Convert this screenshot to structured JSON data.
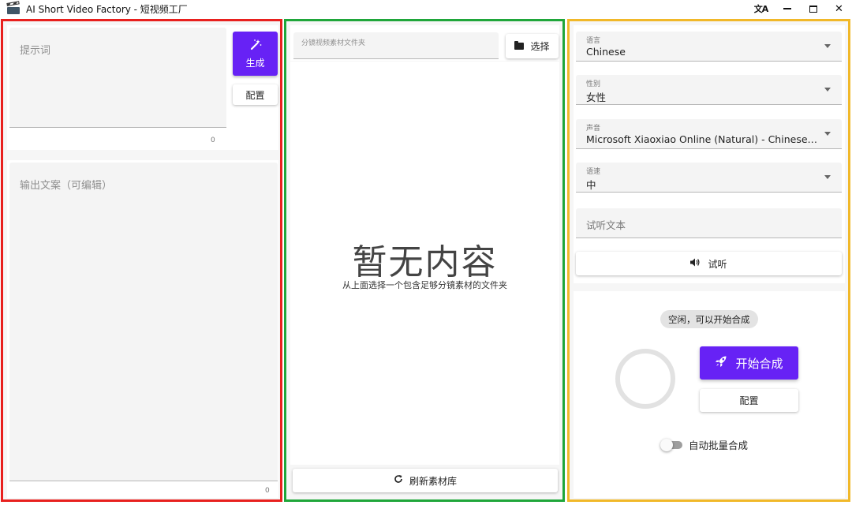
{
  "window": {
    "title": "AI Short Video Factory - 短视频工厂",
    "controls": {
      "translate": "文A",
      "minimize": "",
      "maximize": "",
      "close": "✕"
    }
  },
  "left_panel": {
    "prompt": {
      "placeholder": "提示词",
      "count": "0"
    },
    "generate_button": {
      "icon": "magic-wand-icon",
      "label": "生成"
    },
    "config_button": {
      "label": "配置"
    },
    "output": {
      "placeholder": "输出文案（可编辑）",
      "count": "0"
    }
  },
  "middle_panel": {
    "folder_field": {
      "placeholder": "分镜视频素材文件夹"
    },
    "choose_button": {
      "icon": "folder-icon",
      "label": "选择"
    },
    "empty_state": {
      "title": "暂无内容",
      "subtitle": "从上面选择一个包含足够分镜素材的文件夹"
    },
    "refresh_button": {
      "icon": "refresh-icon",
      "label": "刷新素材库"
    }
  },
  "right_panel": {
    "language": {
      "label": "语言",
      "value": "Chinese"
    },
    "gender": {
      "label": "性别",
      "value": "女性"
    },
    "voice": {
      "label": "声音",
      "value": "Microsoft Xiaoxiao Online (Natural) - Chinese (Mainland)"
    },
    "speed": {
      "label": "语速",
      "value": "中"
    },
    "preview_text": {
      "placeholder": "试听文本"
    },
    "listen_button": {
      "icon": "speaker-icon",
      "label": "试听"
    },
    "status": "空闲，可以开始合成",
    "start_button": {
      "icon": "rocket-icon",
      "label": "开始合成"
    },
    "config_button": {
      "label": "配置"
    },
    "auto_batch": {
      "label": "自动批量合成",
      "enabled": false
    }
  },
  "colors": {
    "primary": "#6722f5",
    "left_outline": "#e8201e",
    "middle_outline": "#1fa63a",
    "right_outline": "#f1b829"
  }
}
